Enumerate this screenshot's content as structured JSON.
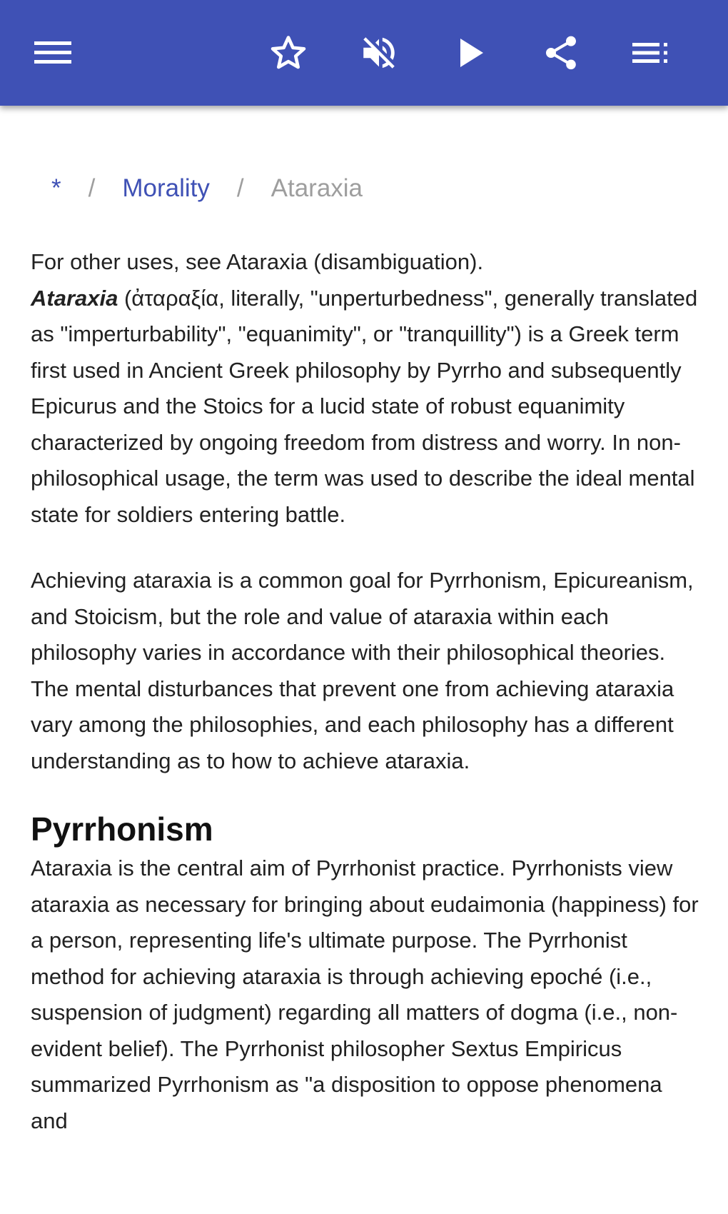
{
  "toolbar": {
    "background": "#3f51b5",
    "icons": [
      "menu-icon",
      "star-icon",
      "volume-off-icon",
      "play-icon",
      "share-icon",
      "playlist-icon"
    ]
  },
  "breadcrumb": {
    "home": "*",
    "separator": "/",
    "category": "Morality",
    "current": "Ataraxia"
  },
  "article": {
    "hatnote": "For other uses, see Ataraxia (disambiguation).",
    "intro_term": "Ataraxia",
    "intro_rest": " (ἀταραξία, literally, \"unperturbedness\", generally translated as \"imperturbability\", \"equanimity\", or \"tranquillity\") is a Greek term first used in Ancient Greek philosophy by Pyrrho and subsequently Epicurus and the Stoics for a lucid state of robust equanimity characterized by ongoing freedom from distress and worry. In non-philosophical usage, the term was used to describe the ideal mental state for soldiers entering battle.",
    "paragraph2": "Achieving ataraxia is a common goal for Pyrrhonism, Epicureanism, and Stoicism, but the role and value of ataraxia within each philosophy varies in accordance with their philosophical theories. The mental disturbances that prevent one from achieving ataraxia vary among the philosophies, and each philosophy has a different understanding as to how to achieve ataraxia.",
    "section_heading": "Pyrrhonism",
    "section_paragraph": "Ataraxia is the central aim of Pyrrhonist practice. Pyrrhonists view ataraxia as necessary for bringing about eudaimonia (happiness) for a person, representing life's ultimate purpose. The Pyrrhonist method for achieving ataraxia is through achieving epoché (i.e., suspension of judgment) regarding all matters of dogma (i.e., non-evident belief). The Pyrrhonist philosopher Sextus Empiricus summarized Pyrrhonism as \"a disposition to oppose phenomena and"
  }
}
